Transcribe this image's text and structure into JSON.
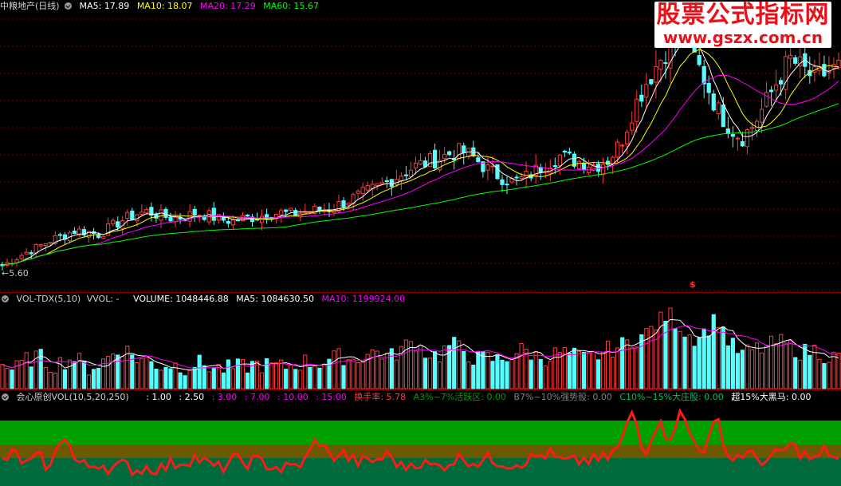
{
  "price_header": {
    "title": "中粮地产(日线)",
    "ma5": "MA5: 17.89",
    "ma10": "MA10: 18.07",
    "ma20": "MA20: 17.29",
    "ma60": "MA60: 15.67"
  },
  "watermark": {
    "title": "股票公式指标网",
    "url": "www.gszx.com.cn"
  },
  "low_label": "←5.60",
  "dollar_mark": "$",
  "vol_header": {
    "name": "VOL-TDX(5,10)",
    "vvol": "VVOL: -",
    "volume": "VOLUME: 1048446.88",
    "ma5": "MA5: 1084630.50",
    "ma10": "MA10: 1199924.00"
  },
  "osc_header": {
    "name": "会心原创VOL(10,5,20,250)",
    "l1": ": 1.00",
    "l2": ": 2.50",
    "l3": ": 3.00",
    "l4": ": 7.00",
    "l5": ": 10.00",
    "l6": ": 15.00",
    "turnover": "换手率: 5.78",
    "a": "A3%~7%活跃区: 0.00",
    "b": "B7%~10%强势股: 0.00",
    "c": "C10%~15%大庄股: 0.00",
    "d": "超15%大黑马: 0.00"
  },
  "colors": {
    "up": "#ff3b3b",
    "down": "#54ffff",
    "ma5": "#ffffff",
    "ma10": "#ffff00",
    "ma20": "#ff00ff",
    "ma60": "#00ff00",
    "band_green": "#00a000",
    "band_olive": "#6b5a00",
    "band_teal": "#006a3c",
    "osc_line": "#ff1a1a"
  },
  "chart_data": {
    "type": "candlestick",
    "series_price": {
      "low": 5.6,
      "trend": [
        6.0,
        6.5,
        7.0,
        7.4,
        7.9,
        8.2,
        8.6,
        8.5,
        8.3,
        8.9,
        9.4,
        9.8,
        10.0,
        9.7,
        9.5,
        9.6,
        9.9,
        9.7,
        9.4,
        9.3,
        9.5,
        9.6,
        9.8,
        9.9,
        9.8,
        10.0,
        10.1,
        10.2,
        10.6,
        11.0,
        11.4,
        11.8,
        12.3,
        12.8,
        13.3,
        13.6,
        13.9,
        14.3,
        14.4,
        13.9,
        13.1,
        12.6,
        12.2,
        12.4,
        13.0,
        13.6,
        14.1,
        13.8,
        13.6,
        13.4,
        13.8,
        15.0,
        17.4,
        19.3,
        20.8,
        22.3,
        23.0,
        21.5,
        19.6,
        17.5,
        16.2,
        15.4,
        16.4,
        18.0,
        19.7,
        21.2,
        20.5,
        19.8,
        20.2,
        20.6
      ]
    },
    "series_volume": {
      "values_rel": [
        0.3,
        0.22,
        0.35,
        0.4,
        0.28,
        0.33,
        0.38,
        0.25,
        0.3,
        0.42,
        0.5,
        0.38,
        0.34,
        0.28,
        0.3,
        0.26,
        0.32,
        0.28,
        0.24,
        0.25,
        0.27,
        0.3,
        0.28,
        0.26,
        0.29,
        0.33,
        0.31,
        0.36,
        0.4,
        0.35,
        0.42,
        0.46,
        0.38,
        0.5,
        0.58,
        0.44,
        0.4,
        0.55,
        0.48,
        0.36,
        0.38,
        0.34,
        0.42,
        0.48,
        0.4,
        0.38,
        0.45,
        0.41,
        0.36,
        0.4,
        0.48,
        0.52,
        0.6,
        0.66,
        0.8,
        0.92,
        0.75,
        0.62,
        0.7,
        0.88,
        0.55,
        0.42,
        0.48,
        0.5,
        0.58,
        0.52,
        0.44,
        0.48,
        0.4,
        0.38
      ]
    },
    "series_osc": {
      "values_rel": [
        0.3,
        0.4,
        0.25,
        0.35,
        0.2,
        0.7,
        0.3,
        0.22,
        0.28,
        0.2,
        0.25,
        0.18,
        0.22,
        0.2,
        0.26,
        0.3,
        0.35,
        0.25,
        0.2,
        0.32,
        0.28,
        0.3,
        0.25,
        0.2,
        0.22,
        0.3,
        0.6,
        0.35,
        0.4,
        0.3,
        0.28,
        0.32,
        0.38,
        0.2,
        0.3,
        0.25,
        0.22,
        0.3,
        0.35,
        0.28,
        0.32,
        0.3,
        0.26,
        0.3,
        0.35,
        0.4,
        0.3,
        0.28,
        0.32,
        0.3,
        0.35,
        0.5,
        0.95,
        0.4,
        0.8,
        0.6,
        0.92,
        0.55,
        0.45,
        0.85,
        0.3,
        0.4,
        0.35,
        0.3,
        0.38,
        0.5,
        0.4,
        0.3,
        0.45,
        0.3
      ]
    }
  }
}
